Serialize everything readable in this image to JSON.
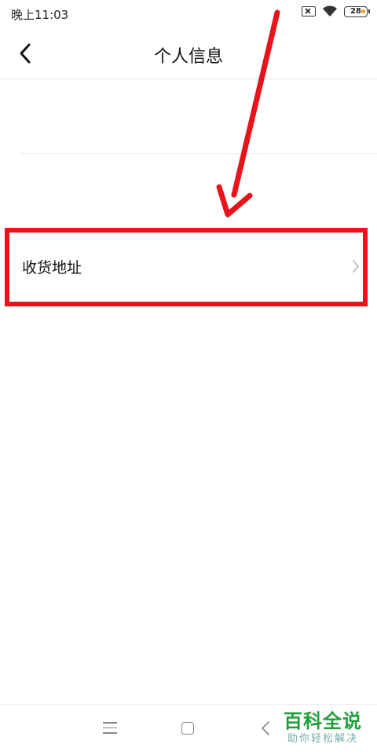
{
  "status_bar": {
    "time": "晚上11:03",
    "battery": "28"
  },
  "header": {
    "title": "个人信息"
  },
  "rows": {
    "address_label": "收货地址"
  },
  "watermark": {
    "main": "百科全说",
    "sub": "助你轻松解决"
  },
  "colors": {
    "annotation": "#e8141b",
    "watermark": "#1f9e3a"
  },
  "icons": [
    "back-icon",
    "chevron-right-icon",
    "wifi-icon",
    "sim-icon",
    "battery-icon",
    "menu-icon",
    "home-icon",
    "system-back-icon"
  ]
}
